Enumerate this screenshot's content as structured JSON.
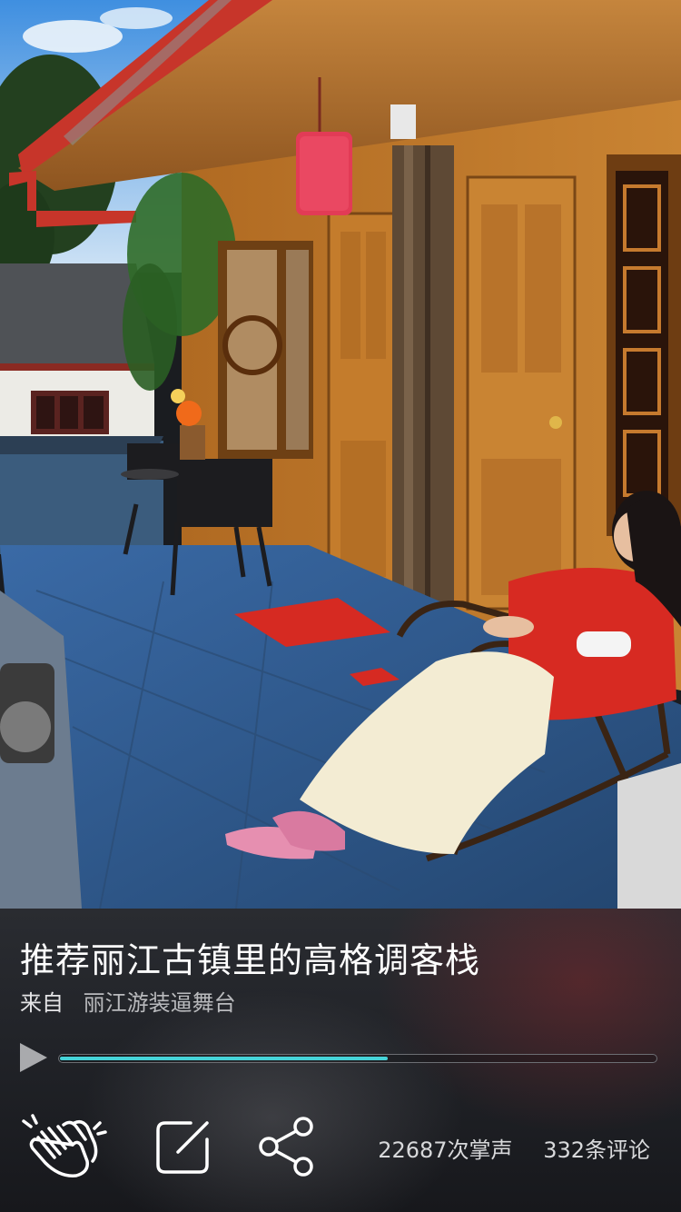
{
  "post": {
    "title": "推荐丽江古镇里的高格调客栈",
    "source_prefix": "来自",
    "source_name": "丽江游装逼舞台"
  },
  "player": {
    "progress": 0.55
  },
  "actions": {
    "clap_count": "22687次掌声",
    "comment_count": "332条评论",
    "icons": [
      "clap-icon",
      "edit-icon",
      "share-icon",
      "play-icon"
    ]
  },
  "colors": {
    "progress_fill": "#46d4d9",
    "dress_red": "#d72a22"
  }
}
